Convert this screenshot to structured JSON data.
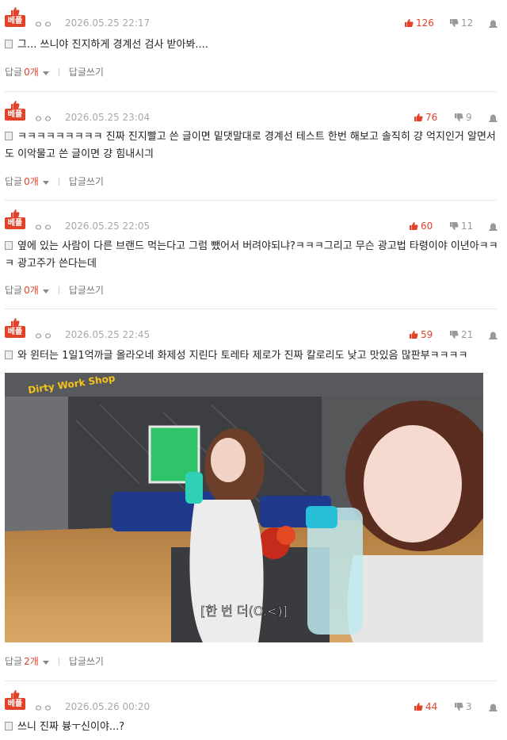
{
  "badge_label": "베플",
  "reply_label": "답글",
  "reply_write_label": "답글쓰기",
  "comments": [
    {
      "author": "ㅇㅇ",
      "date": "2026.05.25 22:17",
      "likes": "126",
      "dislikes": "12",
      "text": "그... 쓰니야 진지하게 경계선 검사 받아봐....",
      "reply_count": "0개"
    },
    {
      "author": "ㅇㅇ",
      "date": "2026.05.25 23:04",
      "likes": "76",
      "dislikes": "9",
      "text": "ㅋㅋㅋㅋㅋㅋㅋㅋㅋ 진짜 진지빨고 쓴 글이면 밑댓말대로 경계선 테스트 한번 해보고 솔직히 걍 억지인거 알면서도 이악물고 쓴 글이면 걍 힘내시긔",
      "reply_count": "0개"
    },
    {
      "author": "ㅇㅇ",
      "date": "2026.05.25 22:05",
      "likes": "60",
      "dislikes": "11",
      "text": "옆에 있는 사람이 다른 브랜드 먹는다고 그럼 뺐어서 버려야되냐?ㅋㅋㅋ그리고 무슨 광고법 타령이야 이년아ㅋㅋㅋ 광고주가 쓴다는데",
      "reply_count": "0개"
    },
    {
      "author": "ㅇㅇ",
      "date": "2026.05.25 22:45",
      "likes": "59",
      "dislikes": "21",
      "text": "와 윈터는 1일1억까글 올라오네 화제성 지린다 토레타 제로가 진짜 칼로리도 낮고 맛있음 많판부ㅋㅋㅋㅋ",
      "reply_count": "2개",
      "media": {
        "watermark": "Dirty Work Shop",
        "subtitle": "[한 번 더(O.<)]"
      }
    },
    {
      "author": "ㅇㅇ",
      "date": "2026.05.26 00:20",
      "likes": "44",
      "dislikes": "3",
      "text": "쓰니 진짜 븅ㅜ신이야...?"
    }
  ],
  "colors": {
    "accent": "#e0422a",
    "muted": "#a8a8a8"
  },
  "icons": {
    "badge": "thumbs-up-icon",
    "like": "thumbs-up-icon",
    "dislike": "thumbs-down-icon",
    "report": "siren-icon",
    "doc": "document-icon"
  }
}
